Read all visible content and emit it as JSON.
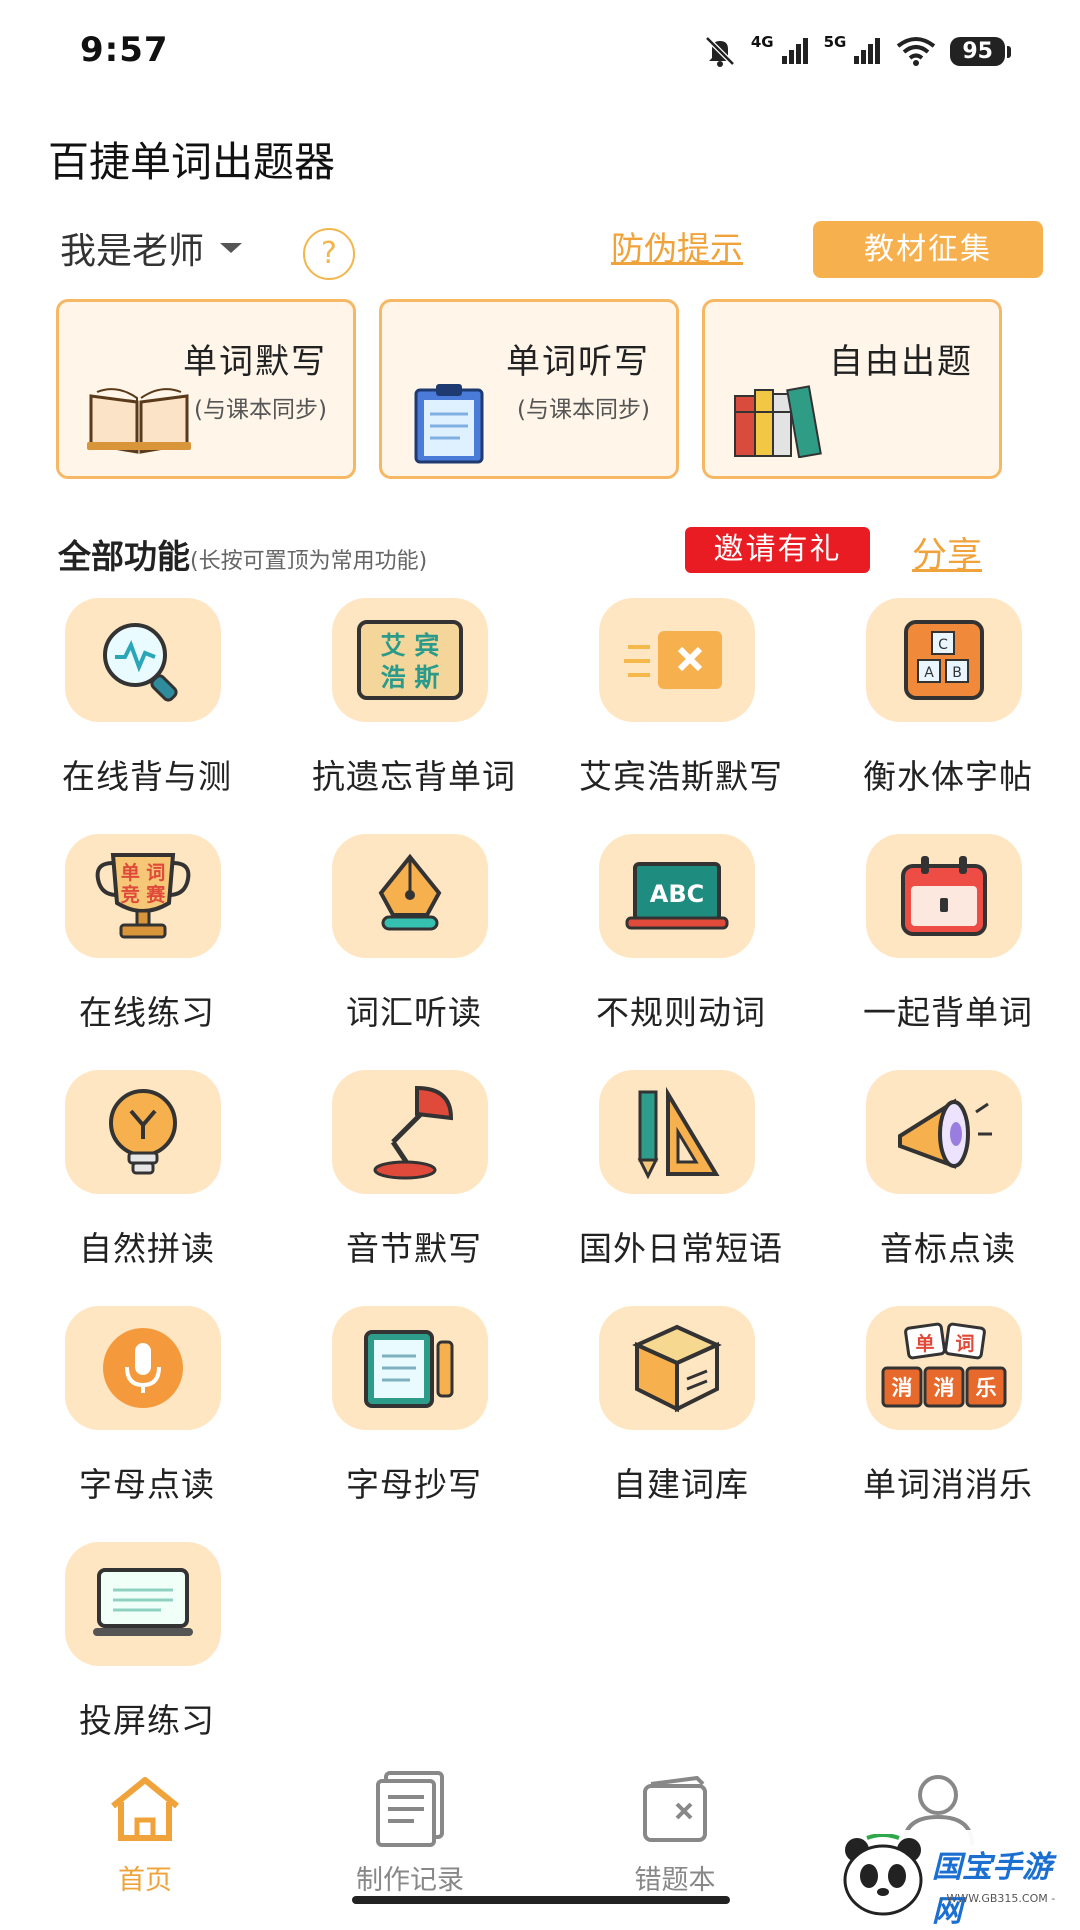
{
  "status_bar": {
    "time": "9:57",
    "net1": "4G",
    "net2": "5G",
    "battery": "95"
  },
  "app": {
    "title": "百捷单词出题器"
  },
  "header": {
    "role": "我是老师",
    "help": "?",
    "anti_fake": "防伪提示",
    "textbook_collect": "教材征集"
  },
  "cards": [
    {
      "title": "单词默写",
      "subtitle": "(与课本同步)"
    },
    {
      "title": "单词听写",
      "subtitle": "(与课本同步)"
    },
    {
      "title": "自由出题",
      "subtitle": ""
    }
  ],
  "section": {
    "title": "全部功能",
    "note": "(长按可置顶为常用功能)",
    "invite": "邀请有礼",
    "share": "分享"
  },
  "features": [
    {
      "label": "在线背与测",
      "icon": "magnifier-icon"
    },
    {
      "label": "抗遗忘背单词",
      "icon": "board-icon",
      "icon_text": [
        "艾 宾",
        "浩 斯"
      ]
    },
    {
      "label": "艾宾浩斯默写",
      "icon": "card-x-icon"
    },
    {
      "label": "衡水体字帖",
      "icon": "abc-blocks-icon"
    },
    {
      "label": "在线练习",
      "icon": "trophy-icon",
      "icon_text": [
        "单 词",
        "竞 赛"
      ]
    },
    {
      "label": "词汇听读",
      "icon": "pen-nib-icon"
    },
    {
      "label": "不规则动词",
      "icon": "abc-laptop-icon",
      "icon_text": [
        "ABC"
      ]
    },
    {
      "label": "一起背单词",
      "icon": "calendar-icon"
    },
    {
      "label": "自然拼读",
      "icon": "bulb-icon"
    },
    {
      "label": "音节默写",
      "icon": "lamp-icon"
    },
    {
      "label": "国外日常短语",
      "icon": "ruler-pencil-icon"
    },
    {
      "label": "音标点读",
      "icon": "megaphone-icon"
    },
    {
      "label": "字母点读",
      "icon": "microphone-icon"
    },
    {
      "label": "字母抄写",
      "icon": "notebook-icon"
    },
    {
      "label": "自建词库",
      "icon": "box-icon"
    },
    {
      "label": "单词消消乐",
      "icon": "tiles-icon",
      "icon_text": [
        "单",
        "词",
        "消",
        "消",
        "乐"
      ]
    },
    {
      "label": "投屏练习",
      "icon": "screen-icon"
    }
  ],
  "bottom_nav": [
    {
      "label": "首页",
      "icon": "home-icon",
      "active": true
    },
    {
      "label": "制作记录",
      "icon": "document-icon",
      "active": false
    },
    {
      "label": "错题本",
      "icon": "wrong-book-icon",
      "active": false
    },
    {
      "label": "",
      "icon": "user-icon",
      "active": false
    }
  ],
  "watermark": {
    "text": "国宝手游网",
    "sub": "- WWW.GB315.COM -"
  },
  "colors": {
    "accent": "#f0a33a",
    "tile_bg": "#ffe6c3",
    "red": "#e91c24",
    "card_border": "#f7b866"
  }
}
